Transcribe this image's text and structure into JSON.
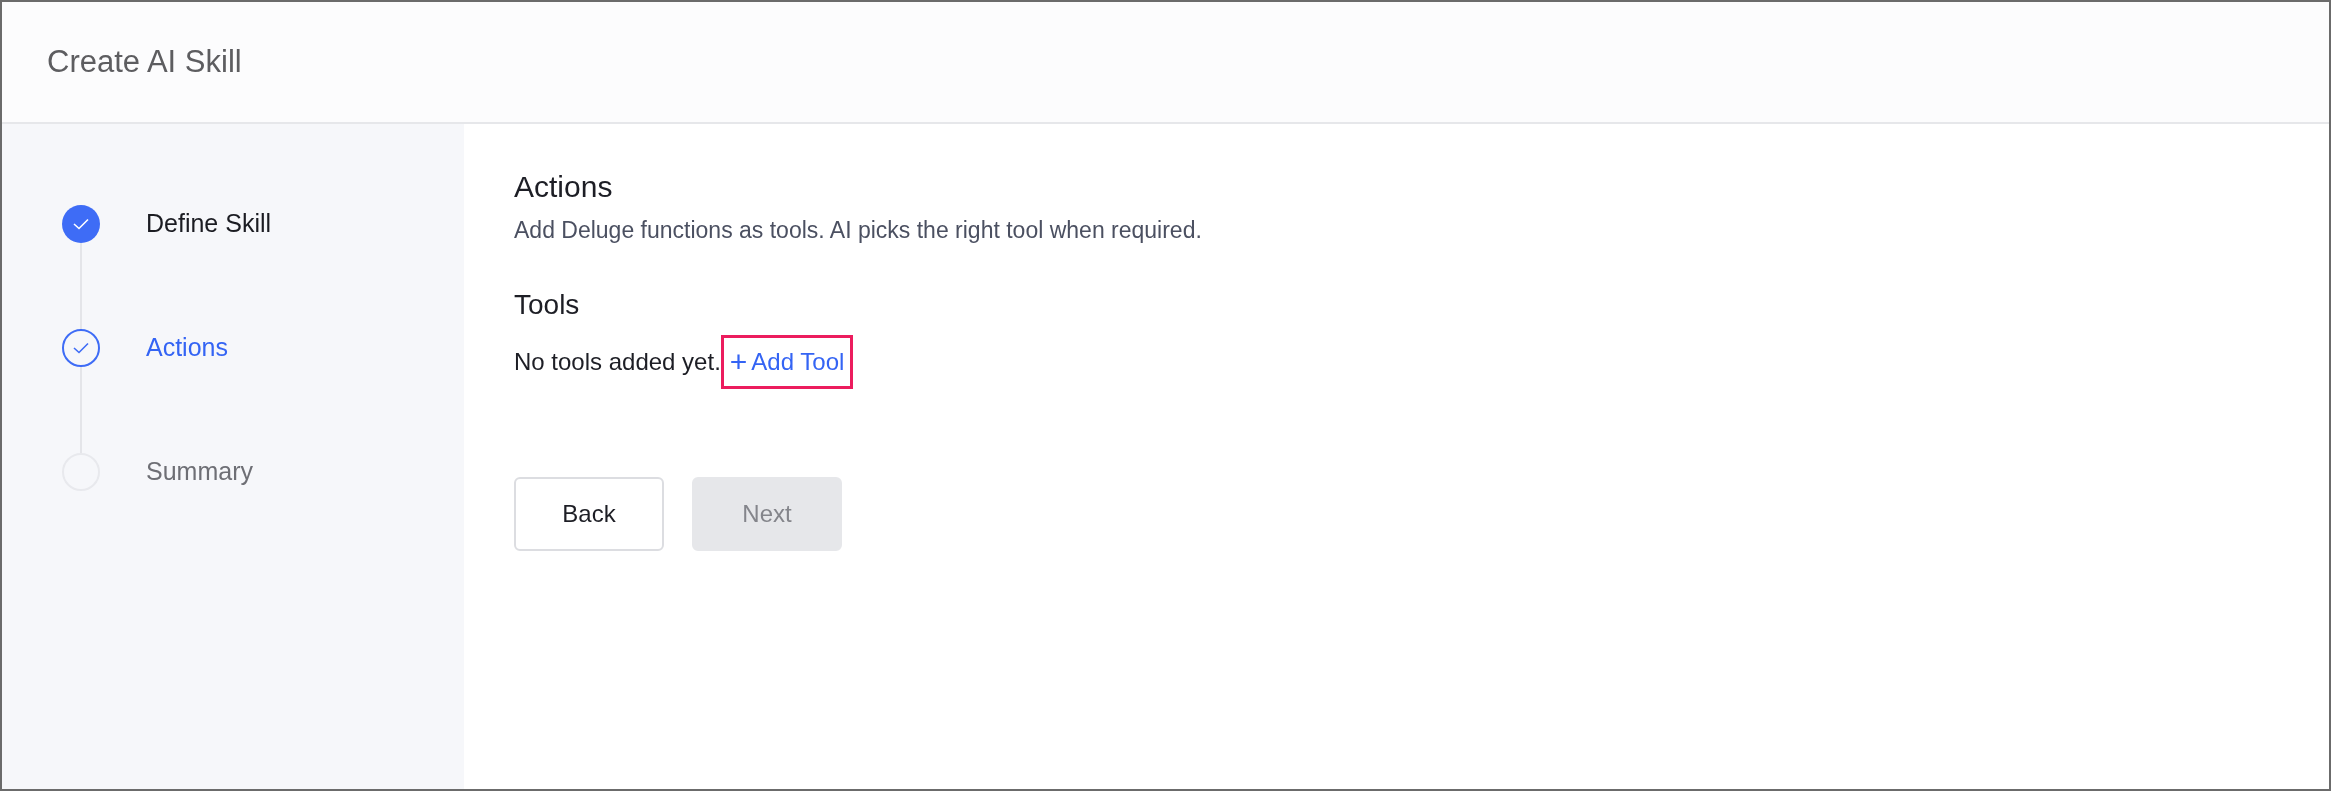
{
  "window": {
    "title": "Create AI Skill"
  },
  "steps": [
    {
      "label": "Define Skill",
      "checked": true,
      "selected": false
    },
    {
      "label": "Actions",
      "checked": true,
      "selected": true
    },
    {
      "label": "Summary",
      "checked": false,
      "selected": false
    }
  ],
  "section": {
    "title": "Actions",
    "description": "Add Deluge functions as tools. AI picks the right tool when required."
  },
  "tools": {
    "title": "Tools",
    "empty_text": "No tools added yet.",
    "add_link": {
      "icon": "+",
      "label": "Add Tool",
      "highlighted": true
    }
  },
  "buttons": [
    {
      "label": "Back",
      "disabled": false
    },
    {
      "label": "Next",
      "disabled": true
    }
  ]
}
